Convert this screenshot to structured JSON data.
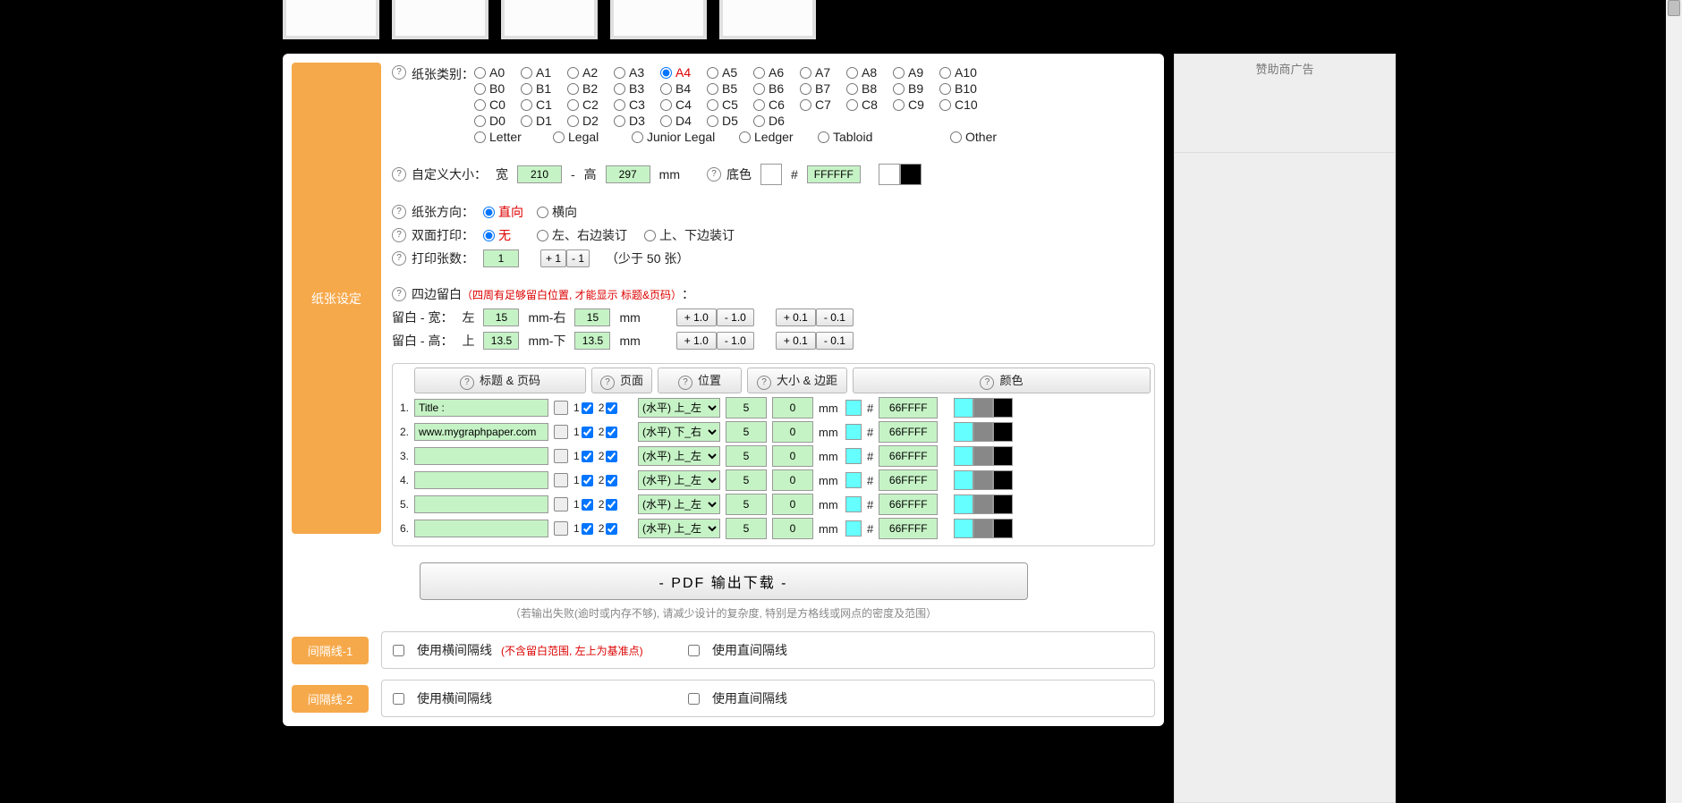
{
  "thumbs_count": 5,
  "panel_title": "纸张设定",
  "paper_type": {
    "label": "纸张类别：",
    "selected": "A4",
    "rows": [
      [
        "A0",
        "A1",
        "A2",
        "A3",
        "A4",
        "A5",
        "A6",
        "A7",
        "A8",
        "A9",
        "A10"
      ],
      [
        "B0",
        "B1",
        "B2",
        "B3",
        "B4",
        "B5",
        "B6",
        "B7",
        "B8",
        "B9",
        "B10"
      ],
      [
        "C0",
        "C1",
        "C2",
        "C3",
        "C4",
        "C5",
        "C6",
        "C7",
        "C8",
        "C9",
        "C10"
      ],
      [
        "D0",
        "D1",
        "D2",
        "D3",
        "D4",
        "D5",
        "D6"
      ]
    ],
    "extra": [
      "Letter",
      "Legal",
      "Junior Legal",
      "Ledger",
      "Tabloid"
    ],
    "other": "Other"
  },
  "custom_size": {
    "label": "自定义大小：",
    "w_label": "宽",
    "w": "210",
    "dash": "-",
    "h_label": "高",
    "h": "297",
    "unit": "mm"
  },
  "base_color": {
    "label": "底色",
    "hash": "#",
    "hex": "FFFFFF"
  },
  "orientation": {
    "label": "纸张方向：",
    "opts": [
      "直向",
      "横向"
    ],
    "selected": "直向"
  },
  "duplex": {
    "label": "双面打印：",
    "opts": [
      "无",
      "左、右边装订",
      "上、下边装订"
    ],
    "selected": "无"
  },
  "copies": {
    "label": "打印张数：",
    "value": "1",
    "plus": "+ 1",
    "minus": "- 1",
    "note": "（少于 50 张）"
  },
  "margins": {
    "label": "四边留白",
    "note": "（四周有足够留白位置, 才能显示 标题&页码）",
    "colon": "：",
    "w_label": "留白 - 宽：",
    "left_l": "左",
    "left": "15",
    "right_l": "右",
    "right": "15",
    "h_label": "留白 - 高：",
    "top_l": "上",
    "top": "13.5",
    "bot_l": "下",
    "bot": "13.5",
    "unit": "mm",
    "btns": [
      "+ 1.0",
      "- 1.0",
      "+ 0.1",
      "- 0.1"
    ]
  },
  "title_section": {
    "headers": [
      "标题 & 页码",
      "页面",
      "位置",
      "大小 & 边距",
      "颜色"
    ],
    "pos_opts": [
      "(水平) 上_左",
      "(水平) 下_右"
    ],
    "unit": "mm",
    "hash": "#",
    "rows": [
      {
        "n": "1.",
        "text": "Title :",
        "pos": "(水平) 上_左",
        "v1": "5",
        "v2": "0",
        "hex": "66FFFF"
      },
      {
        "n": "2.",
        "text": "www.mygraphpaper.com",
        "pos": "(水平) 下_右",
        "v1": "5",
        "v2": "0",
        "hex": "66FFFF"
      },
      {
        "n": "3.",
        "text": "",
        "pos": "(水平) 上_左",
        "v1": "5",
        "v2": "0",
        "hex": "66FFFF"
      },
      {
        "n": "4.",
        "text": "",
        "pos": "(水平) 上_左",
        "v1": "5",
        "v2": "0",
        "hex": "66FFFF"
      },
      {
        "n": "5.",
        "text": "",
        "pos": "(水平) 上_左",
        "v1": "5",
        "v2": "0",
        "hex": "66FFFF"
      },
      {
        "n": "6.",
        "text": "",
        "pos": "(水平) 上_左",
        "v1": "5",
        "v2": "0",
        "hex": "66FFFF"
      }
    ],
    "page_labels": [
      "1",
      "2"
    ],
    "swatches": [
      "#66FFFF",
      "#888888",
      "#000000"
    ]
  },
  "download_btn": "- PDF 输出下载 -",
  "download_hint": "（若输出失败(逾时或内存不够), 请减少设计的复杂度, 特别是方格线或网点的密度及范围）",
  "sep1": {
    "label": "间隔线-1",
    "h": "使用横间隔线",
    "h_note": "(不含留白范围, 左上为基准点)",
    "v": "使用直间隔线"
  },
  "sep2": {
    "label": "间隔线-2",
    "h": "使用横间隔线",
    "v": "使用直间隔线"
  },
  "ads_title": "赞助商广告"
}
